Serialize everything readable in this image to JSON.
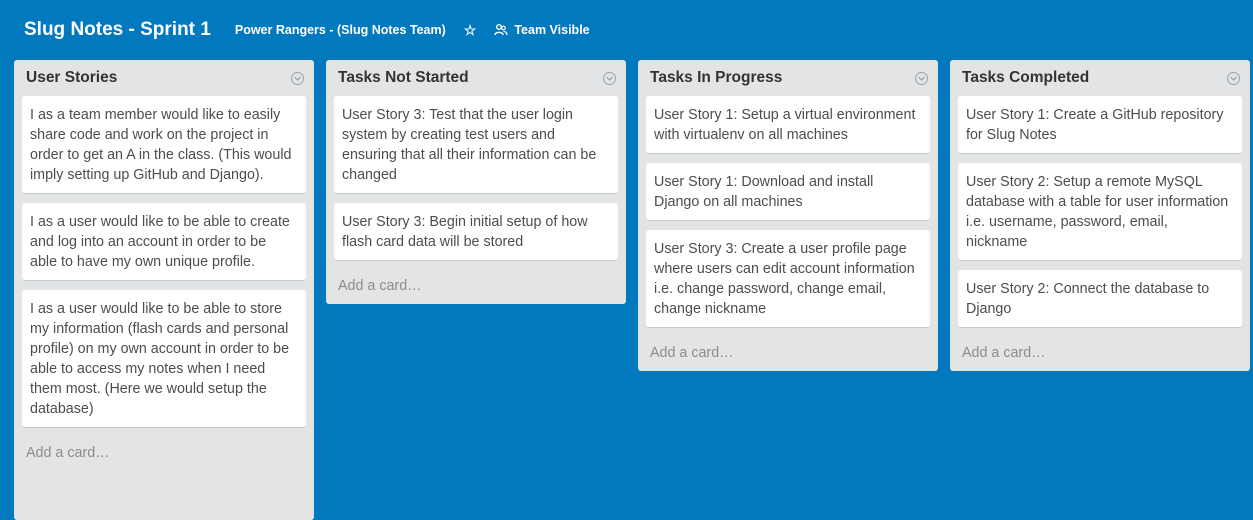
{
  "board": {
    "title": "Slug Notes - Sprint 1",
    "team": "Power Rangers - (Slug Notes Team)",
    "star_icon": "star-icon",
    "visibility": "Team Visible",
    "background_color": "#0079bf"
  },
  "lists": [
    {
      "title": "User Stories",
      "cards": [
        "I as a team member would like to easily share code and work on the project in order to get an A in the class. (This would imply setting up GitHub and Django).",
        "I as a user would like to be able to create and log into an account in order to be able to have my own unique profile.",
        "I as a user would like to be able to store my information (flash cards and personal profile) on my own account in order to be able to access my notes when I need them most. (Here we would setup the database)"
      ],
      "add_card": "Add a card…"
    },
    {
      "title": "Tasks Not Started",
      "cards": [
        "User Story 3: Test that the user login system by creating test users and ensuring that all their information can be changed",
        "User Story 3: Begin initial setup of how flash card data will be stored"
      ],
      "add_card": "Add a card…"
    },
    {
      "title": "Tasks In Progress",
      "cards": [
        "User Story 1: Setup a virtual environment with virtualenv on all machines",
        "User Story 1: Download and install Django on all machines",
        "User Story 3: Create a user profile page where users can edit account information i.e. change password, change email, change nickname"
      ],
      "add_card": "Add a card…"
    },
    {
      "title": "Tasks Completed",
      "cards": [
        "User Story 1: Create a GitHub repository for Slug Notes",
        "User Story 2: Setup a remote MySQL database with a table for user information i.e. username, password, email, nickname",
        "User Story 2: Connect the database to Django"
      ],
      "add_card": "Add a card…"
    }
  ]
}
